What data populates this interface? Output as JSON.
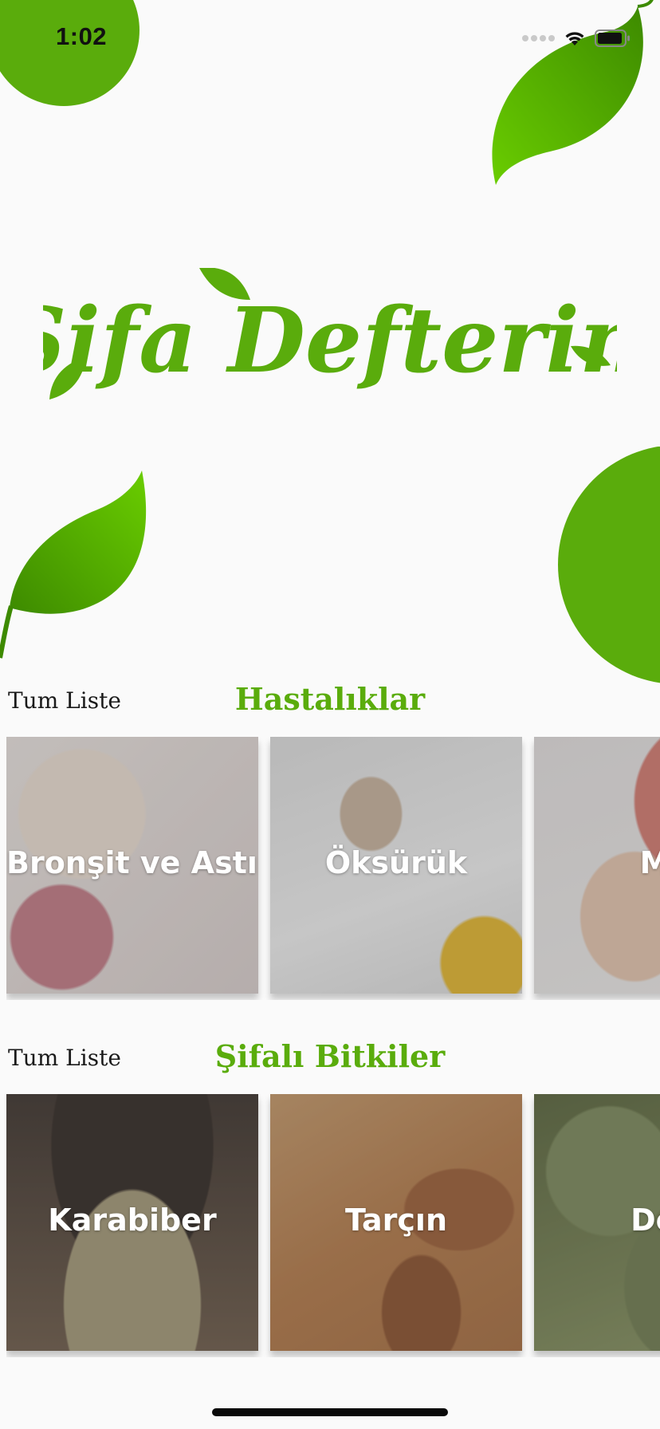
{
  "status_bar": {
    "time": "1:02"
  },
  "logo": {
    "text": "Şifa Defterim",
    "color": "#5aac0c"
  },
  "colors": {
    "accent": "#5aac0c",
    "leaf_light": "#6acd00",
    "leaf_dark": "#3d8a00"
  },
  "diseases": {
    "link_label": "Tum Liste",
    "title": "Hastalıklar",
    "cards": [
      {
        "label": "Bronşit ve Astım"
      },
      {
        "label": "Öksürük"
      },
      {
        "label": "Mi"
      }
    ]
  },
  "herbs": {
    "link_label": "Tum Liste",
    "title": "Şifalı Bitkiler",
    "cards": [
      {
        "label": "Karabiber"
      },
      {
        "label": "Tarçın"
      },
      {
        "label": "Def"
      }
    ]
  }
}
